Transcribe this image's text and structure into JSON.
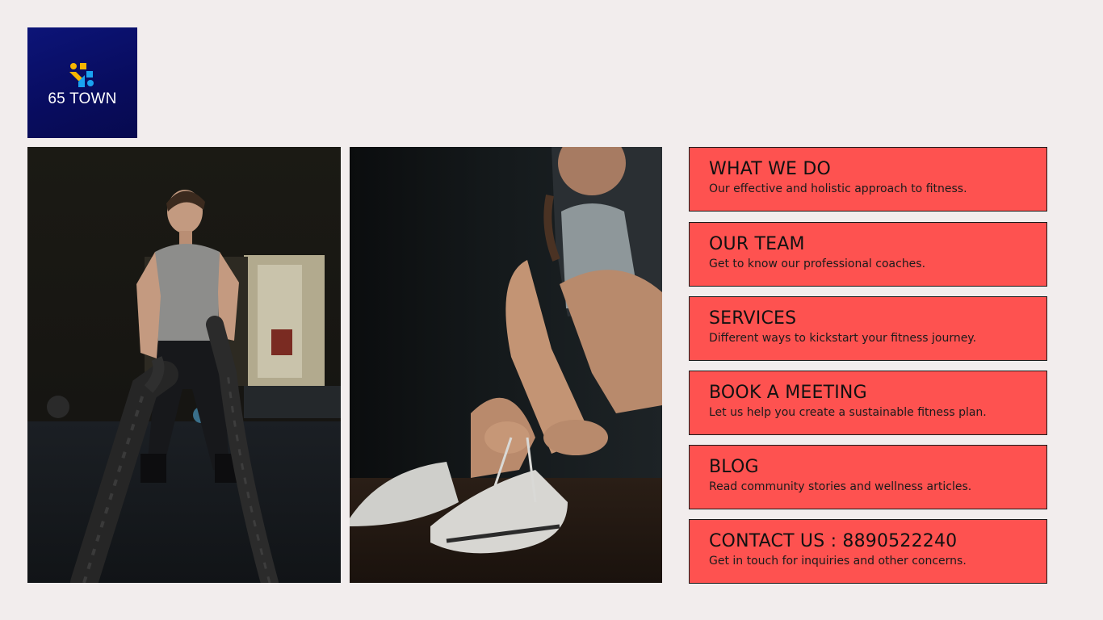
{
  "brand": {
    "name": "65 TOWN",
    "logo_icon": "65-town-logo-icon",
    "colors": {
      "navy": "#0a1170",
      "yellow": "#f7b500",
      "blue": "#1aa3f0"
    }
  },
  "photos": [
    {
      "subject": "man training with battle ropes in gym"
    },
    {
      "subject": "woman tying sneaker laces"
    }
  ],
  "cards": [
    {
      "title": "WHAT WE DO",
      "description": "Our effective and holistic approach to fitness."
    },
    {
      "title": "OUR TEAM",
      "description": "Get to know our professional coaches."
    },
    {
      "title": "SERVICES",
      "description": "Different ways to kickstart your fitness journey."
    },
    {
      "title": "BOOK A MEETING",
      "description": "Let us help you create a sustainable fitness plan."
    },
    {
      "title": "BLOG",
      "description": "Read community stories and wellness articles."
    },
    {
      "title": "CONTACT US : 8890522240",
      "description": "Get in touch for inquiries and other concerns."
    }
  ],
  "theme": {
    "background": "#f2eded",
    "card_fill": "#fe5250",
    "card_border": "#1a1a1a"
  }
}
